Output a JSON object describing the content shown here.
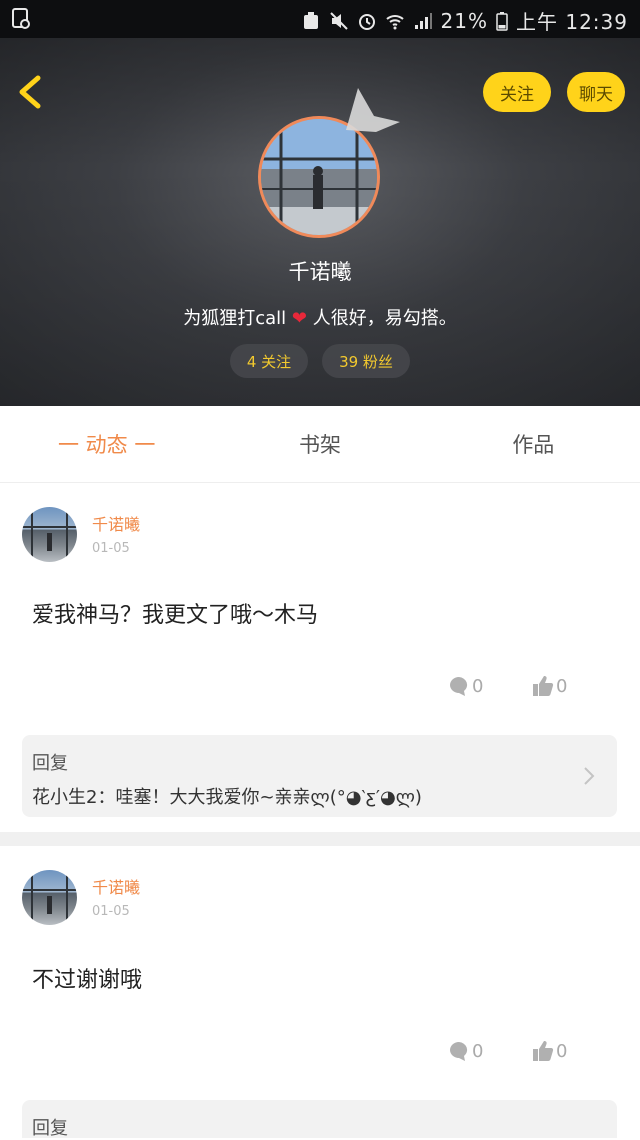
{
  "status_bar": {
    "battery": "21%",
    "time": "上午 12:39",
    "icons": [
      "screen-record-icon",
      "alarm-icon",
      "mute-icon",
      "wifi-icon",
      "signal-icon",
      "battery-icon"
    ]
  },
  "header": {
    "follow_label": "关注",
    "chat_label": "聊天",
    "user_name": "千诺曦",
    "bio_before": "为狐狸打call",
    "bio_heart": "❤",
    "bio_after": "人很好，易勾搭。",
    "following": "4 关注",
    "fans": "39 粉丝",
    "colors": {
      "accent": "#ffd31a",
      "avatar_ring": "#f08a5a"
    }
  },
  "tabs": [
    {
      "label": "一 动态 一",
      "active": true
    },
    {
      "label": "书架",
      "active": false
    },
    {
      "label": "作品",
      "active": false
    }
  ],
  "posts": [
    {
      "author": "千诺曦",
      "date": "01-05",
      "text": "爱我神马？我更文了哦～木马",
      "comments": "0",
      "likes": "0",
      "reply_title": "回复",
      "reply_content": "花小生2：哇塞！大大我爱你~亲亲ლ(°◕‵ƹ′◕ლ)"
    },
    {
      "author": "千诺曦",
      "date": "01-05",
      "text": "不过谢谢哦",
      "comments": "0",
      "likes": "0",
      "reply_title": "回复"
    }
  ],
  "colors": {
    "tab_active": "#f08a4a",
    "author": "#f08a4a"
  }
}
